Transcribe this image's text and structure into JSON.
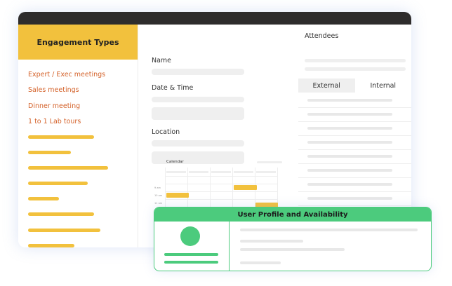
{
  "sidebar": {
    "title": "Engagement Types",
    "items": [
      {
        "label": "Expert / Exec meetings"
      },
      {
        "label": "Sales meetings"
      },
      {
        "label": "Dinner meeting"
      },
      {
        "label": "1 to 1 Lab tours"
      }
    ]
  },
  "form": {
    "name_label": "Name",
    "datetime_label": "Date & Time",
    "location_label": "Location"
  },
  "calendar": {
    "title": "Calendar",
    "times": [
      "9 am",
      "10 am",
      "11 am"
    ]
  },
  "attendees": {
    "title": "Attendees",
    "tabs": [
      {
        "label": "External",
        "active": true
      },
      {
        "label": "Internal",
        "active": false
      }
    ]
  },
  "profile_card": {
    "title": "User Profile and Availability"
  },
  "colors": {
    "accent_yellow": "#f2c13d",
    "accent_green": "#4ccb7d",
    "link_orange": "#d4622a",
    "titlebar": "#2e2c2c"
  }
}
